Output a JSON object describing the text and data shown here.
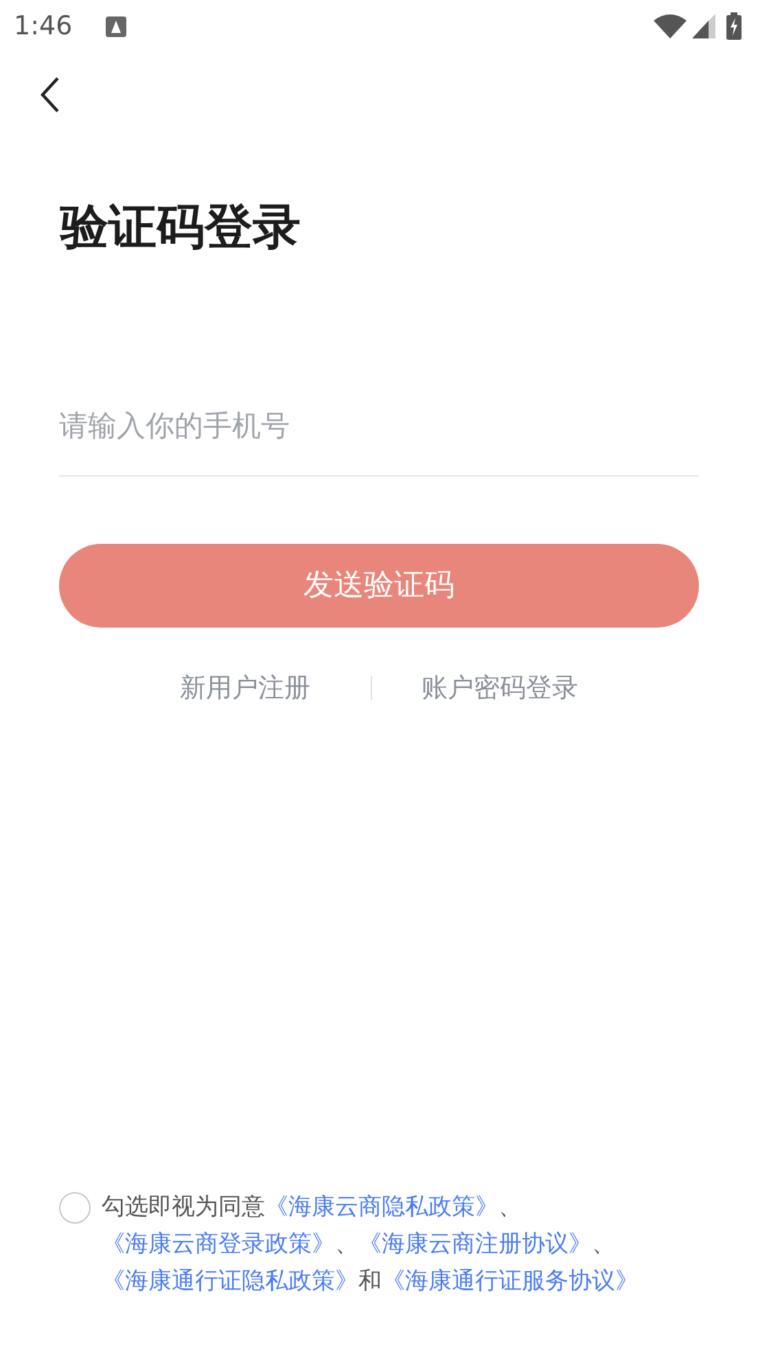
{
  "status_bar": {
    "time": "1:46"
  },
  "title": "验证码登录",
  "phone_field": {
    "placeholder": "请输入你的手机号"
  },
  "send_button": {
    "label": "发送验证码",
    "disabled": true
  },
  "links": [
    "新用户注册",
    "账户密码登录"
  ],
  "agreement": {
    "checked": false,
    "parts": [
      {
        "kind": "text",
        "text": "勾选即视为同意"
      },
      {
        "kind": "link",
        "text": "《海康云商隐私政策》"
      },
      {
        "kind": "text",
        "text": "、"
      },
      {
        "kind": "link",
        "text": "《海康云商登录政策》"
      },
      {
        "kind": "text",
        "text": "、"
      },
      {
        "kind": "link",
        "text": "《海康云商注册协议》"
      },
      {
        "kind": "text",
        "text": "、"
      },
      {
        "kind": "link",
        "text": "《海康通行证隐私政策》"
      },
      {
        "kind": "text",
        "text": "和"
      },
      {
        "kind": "link",
        "text": "《海康通行证服务协议》"
      }
    ]
  }
}
